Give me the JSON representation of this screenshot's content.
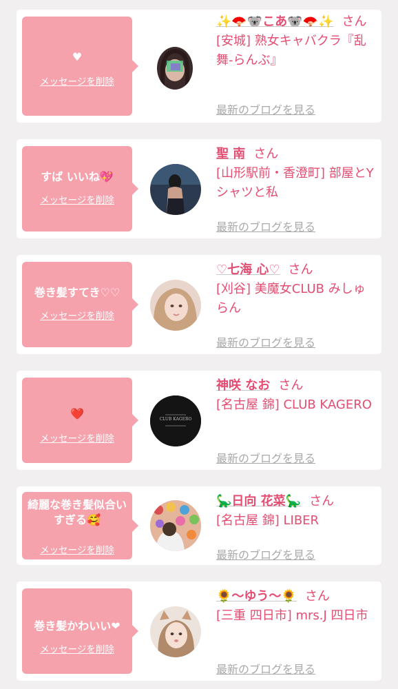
{
  "items": [
    {
      "message": "♥",
      "delete_label": "メッセージを削除",
      "name": "✨🪭🐨こあ🐨🪭✨",
      "honorific": "さん",
      "shop": "[安城] 熟女キャバクラ『乱舞-らんぶ』",
      "blog_label": "最新のブログを見る"
    },
    {
      "message": "すば いいね💖",
      "delete_label": "メッセージを削除",
      "name": "聖 南",
      "honorific": "さん",
      "shop": "[山形駅前・香澄町] 部屋とYシャツと私",
      "blog_label": "最新のブログを見る"
    },
    {
      "message": "巻き髪すてき♡♡",
      "delete_label": "メッセージを削除",
      "name": "♡七海 心♡",
      "honorific": "さん",
      "shop": "[刈谷] 美魔女CLUB みしゅらん",
      "blog_label": "最新のブログを見る"
    },
    {
      "message": "❤️",
      "delete_label": "メッセージを削除",
      "name": "神咲 なお",
      "honorific": "さん",
      "shop": "[名古屋 錦] CLUB KAGERO",
      "avatar_text": "CLUB KAGERO",
      "blog_label": "最新のブログを見る"
    },
    {
      "message": "綺麗な巻き髪似合いすぎる🥰",
      "delete_label": "メッセージを削除",
      "name": "🦕日向 花菜🦕",
      "honorific": "さん",
      "shop": "[名古屋 錦] LIBER",
      "blog_label": "最新のブログを見る"
    },
    {
      "message": "巻き髪かわいい❤",
      "delete_label": "メッセージを削除",
      "name": "🌻〜ゆう〜🌻",
      "honorific": "さん",
      "shop": "[三重 四日市] mrs.J 四日市",
      "blog_label": "最新のブログを見る"
    }
  ]
}
